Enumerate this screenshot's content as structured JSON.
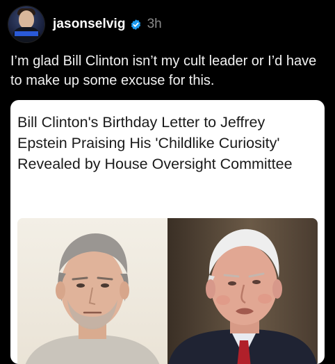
{
  "post": {
    "username": "jasonselvig",
    "timestamp": "3h",
    "text": "I’m glad Bill Clinton isn’t my cult leader or I’d have to make up some excuse for this.",
    "verified_icon": "verified-badge-icon"
  },
  "link_card": {
    "title": "Bill Clinton's Birthday Letter to Jeffrey Epstein Praising His 'Childlike Curiosity' Revealed by House Oversight Committee"
  },
  "colors": {
    "background": "#000000",
    "verified": "#1d9bf0",
    "timestamp": "#8a8a8a"
  }
}
